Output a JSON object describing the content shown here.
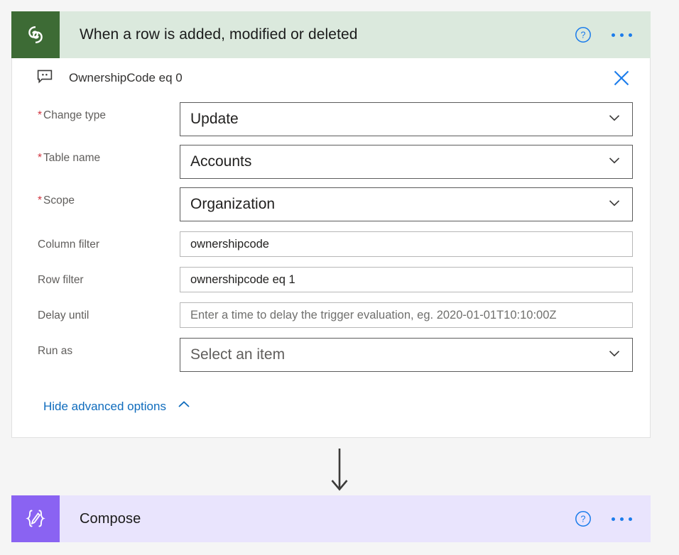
{
  "trigger": {
    "title": "When a row is added, modified or deleted",
    "icon": "dataverse-icon",
    "header_color": "#dbe9dd",
    "icon_color": "#3d6b35",
    "help_icon": "help-circle-icon",
    "more_icon": "ellipsis-icon",
    "comment": {
      "icon": "comment-icon",
      "text": "OwnershipCode eq 0",
      "close_icon": "close-icon"
    },
    "fields": [
      {
        "label": "Change type",
        "required": true,
        "control": "dropdown",
        "value": "Update",
        "is_placeholder": false
      },
      {
        "label": "Table name",
        "required": true,
        "control": "dropdown",
        "value": "Accounts",
        "is_placeholder": false
      },
      {
        "label": "Scope",
        "required": true,
        "control": "dropdown",
        "value": "Organization",
        "is_placeholder": false
      },
      {
        "label": "Column filter",
        "required": false,
        "control": "text",
        "value": "ownershipcode",
        "is_placeholder": false
      },
      {
        "label": "Row filter",
        "required": false,
        "control": "text",
        "value": "ownershipcode eq 1",
        "is_placeholder": false
      },
      {
        "label": "Delay until",
        "required": false,
        "control": "text",
        "value": "Enter a time to delay the trigger evaluation, eg. 2020-01-01T10:10:00Z",
        "is_placeholder": true
      },
      {
        "label": "Run as",
        "required": false,
        "control": "dropdown",
        "value": "Select an item",
        "is_placeholder": true
      }
    ],
    "advanced_link": {
      "label": "Hide advanced options",
      "icon": "chevron-up-icon"
    }
  },
  "connector": {
    "icon": "arrow-down-icon",
    "color": "#3b3a39"
  },
  "compose": {
    "title": "Compose",
    "icon": "compose-braces-pencil-icon",
    "header_color": "#e9e4fd",
    "icon_color": "#8a63f2",
    "help_icon": "help-circle-icon",
    "more_icon": "ellipsis-icon"
  },
  "theme": {
    "accent_blue": "#1b7ceb",
    "link_blue": "#0f6cbd",
    "required_red": "#d1343f",
    "canvas_bg": "#f5f5f5"
  }
}
